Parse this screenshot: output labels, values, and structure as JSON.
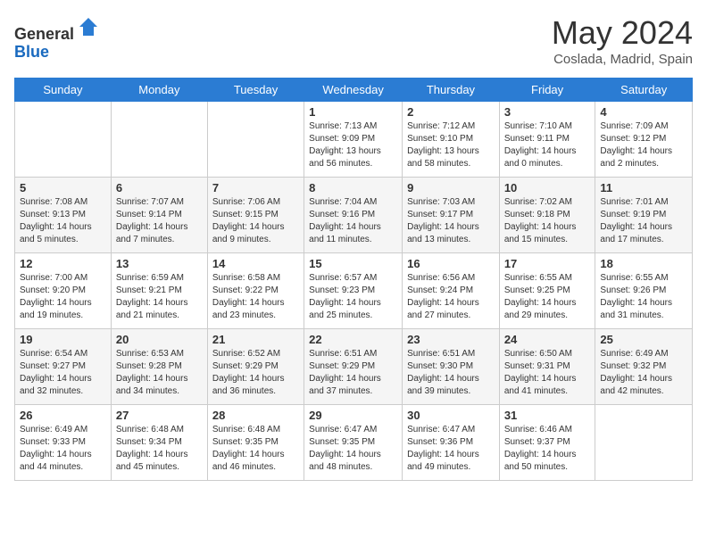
{
  "header": {
    "logo_line1": "General",
    "logo_line2": "Blue",
    "month_title": "May 2024",
    "subtitle": "Coslada, Madrid, Spain"
  },
  "days_of_week": [
    "Sunday",
    "Monday",
    "Tuesday",
    "Wednesday",
    "Thursday",
    "Friday",
    "Saturday"
  ],
  "weeks": [
    [
      {
        "day": "",
        "info": ""
      },
      {
        "day": "",
        "info": ""
      },
      {
        "day": "",
        "info": ""
      },
      {
        "day": "1",
        "info": "Sunrise: 7:13 AM\nSunset: 9:09 PM\nDaylight: 13 hours and 56 minutes."
      },
      {
        "day": "2",
        "info": "Sunrise: 7:12 AM\nSunset: 9:10 PM\nDaylight: 13 hours and 58 minutes."
      },
      {
        "day": "3",
        "info": "Sunrise: 7:10 AM\nSunset: 9:11 PM\nDaylight: 14 hours and 0 minutes."
      },
      {
        "day": "4",
        "info": "Sunrise: 7:09 AM\nSunset: 9:12 PM\nDaylight: 14 hours and 2 minutes."
      }
    ],
    [
      {
        "day": "5",
        "info": "Sunrise: 7:08 AM\nSunset: 9:13 PM\nDaylight: 14 hours and 5 minutes."
      },
      {
        "day": "6",
        "info": "Sunrise: 7:07 AM\nSunset: 9:14 PM\nDaylight: 14 hours and 7 minutes."
      },
      {
        "day": "7",
        "info": "Sunrise: 7:06 AM\nSunset: 9:15 PM\nDaylight: 14 hours and 9 minutes."
      },
      {
        "day": "8",
        "info": "Sunrise: 7:04 AM\nSunset: 9:16 PM\nDaylight: 14 hours and 11 minutes."
      },
      {
        "day": "9",
        "info": "Sunrise: 7:03 AM\nSunset: 9:17 PM\nDaylight: 14 hours and 13 minutes."
      },
      {
        "day": "10",
        "info": "Sunrise: 7:02 AM\nSunset: 9:18 PM\nDaylight: 14 hours and 15 minutes."
      },
      {
        "day": "11",
        "info": "Sunrise: 7:01 AM\nSunset: 9:19 PM\nDaylight: 14 hours and 17 minutes."
      }
    ],
    [
      {
        "day": "12",
        "info": "Sunrise: 7:00 AM\nSunset: 9:20 PM\nDaylight: 14 hours and 19 minutes."
      },
      {
        "day": "13",
        "info": "Sunrise: 6:59 AM\nSunset: 9:21 PM\nDaylight: 14 hours and 21 minutes."
      },
      {
        "day": "14",
        "info": "Sunrise: 6:58 AM\nSunset: 9:22 PM\nDaylight: 14 hours and 23 minutes."
      },
      {
        "day": "15",
        "info": "Sunrise: 6:57 AM\nSunset: 9:23 PM\nDaylight: 14 hours and 25 minutes."
      },
      {
        "day": "16",
        "info": "Sunrise: 6:56 AM\nSunset: 9:24 PM\nDaylight: 14 hours and 27 minutes."
      },
      {
        "day": "17",
        "info": "Sunrise: 6:55 AM\nSunset: 9:25 PM\nDaylight: 14 hours and 29 minutes."
      },
      {
        "day": "18",
        "info": "Sunrise: 6:55 AM\nSunset: 9:26 PM\nDaylight: 14 hours and 31 minutes."
      }
    ],
    [
      {
        "day": "19",
        "info": "Sunrise: 6:54 AM\nSunset: 9:27 PM\nDaylight: 14 hours and 32 minutes."
      },
      {
        "day": "20",
        "info": "Sunrise: 6:53 AM\nSunset: 9:28 PM\nDaylight: 14 hours and 34 minutes."
      },
      {
        "day": "21",
        "info": "Sunrise: 6:52 AM\nSunset: 9:29 PM\nDaylight: 14 hours and 36 minutes."
      },
      {
        "day": "22",
        "info": "Sunrise: 6:51 AM\nSunset: 9:29 PM\nDaylight: 14 hours and 37 minutes."
      },
      {
        "day": "23",
        "info": "Sunrise: 6:51 AM\nSunset: 9:30 PM\nDaylight: 14 hours and 39 minutes."
      },
      {
        "day": "24",
        "info": "Sunrise: 6:50 AM\nSunset: 9:31 PM\nDaylight: 14 hours and 41 minutes."
      },
      {
        "day": "25",
        "info": "Sunrise: 6:49 AM\nSunset: 9:32 PM\nDaylight: 14 hours and 42 minutes."
      }
    ],
    [
      {
        "day": "26",
        "info": "Sunrise: 6:49 AM\nSunset: 9:33 PM\nDaylight: 14 hours and 44 minutes."
      },
      {
        "day": "27",
        "info": "Sunrise: 6:48 AM\nSunset: 9:34 PM\nDaylight: 14 hours and 45 minutes."
      },
      {
        "day": "28",
        "info": "Sunrise: 6:48 AM\nSunset: 9:35 PM\nDaylight: 14 hours and 46 minutes."
      },
      {
        "day": "29",
        "info": "Sunrise: 6:47 AM\nSunset: 9:35 PM\nDaylight: 14 hours and 48 minutes."
      },
      {
        "day": "30",
        "info": "Sunrise: 6:47 AM\nSunset: 9:36 PM\nDaylight: 14 hours and 49 minutes."
      },
      {
        "day": "31",
        "info": "Sunrise: 6:46 AM\nSunset: 9:37 PM\nDaylight: 14 hours and 50 minutes."
      },
      {
        "day": "",
        "info": ""
      }
    ]
  ]
}
